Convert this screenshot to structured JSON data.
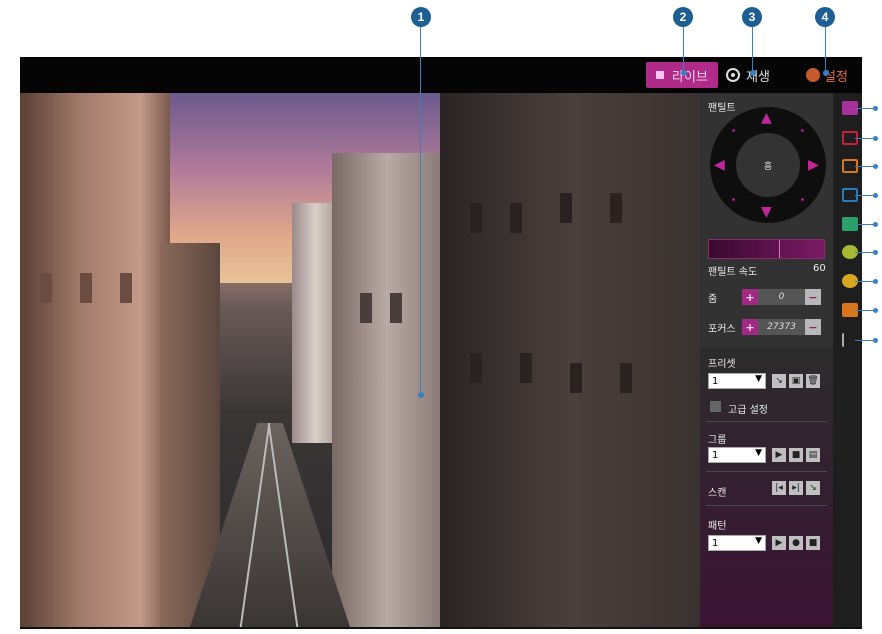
{
  "callouts": [
    "1",
    "2",
    "3",
    "4"
  ],
  "topbar": {
    "live_label": "라이브",
    "playback_label": "재생",
    "settings_label": "설정"
  },
  "ptz": {
    "title": "팬틸트",
    "home_label": "홈",
    "speed_label": "팬틸트 속도",
    "speed_value": "60",
    "zoom_label": "줌",
    "zoom_value": "0",
    "focus_label": "포커스",
    "focus_value": "27373",
    "plus": "+",
    "minus": "−"
  },
  "preset": {
    "title": "프리셋",
    "select_value": "1",
    "advanced_label": "고급 설정"
  },
  "group": {
    "title": "그룹",
    "select_value": "1"
  },
  "scan": {
    "title": "스캔"
  },
  "pattern": {
    "title": "패턴",
    "select_value": "1"
  },
  "colors": {
    "accent": "#b02a8a",
    "callout": "#1d5e93",
    "settings": "#e36b3a"
  },
  "sidebar_icons": [
    "fullscreen-icon",
    "record-icon",
    "capture-icon",
    "audio-icon",
    "snapshot-icon",
    "reel-icon",
    "mic-icon",
    "speaker-icon",
    "collapse-icon"
  ]
}
